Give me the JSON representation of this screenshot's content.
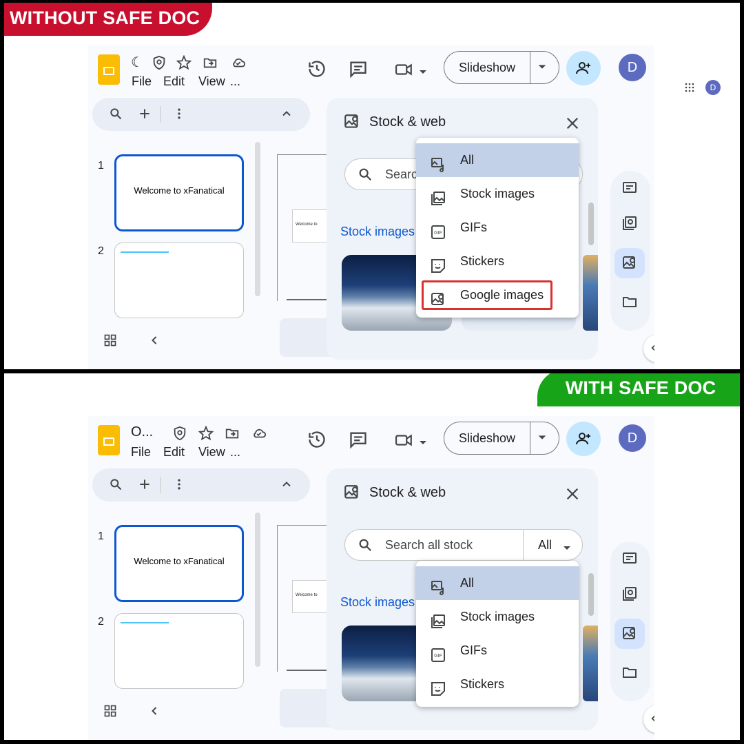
{
  "top_badge": "WITHOUT SAFE DOC",
  "bottom_badge": "WITH SAFE DOC",
  "colors": {
    "badge_red": "#c8102e",
    "badge_green": "#18a418",
    "accent_blue": "#0b57d0",
    "highlight_red": "#d93030"
  },
  "top": {
    "doc_title": "☾",
    "menus": [
      "File",
      "Edit",
      "View",
      "..."
    ],
    "slideshow_label": "Slideshow",
    "avatar_letter": "D",
    "outside_avatar_letter": "D",
    "slides": [
      {
        "number": "1",
        "title": "Welcome to xFanatical"
      },
      {
        "number": "2",
        "title": ""
      }
    ],
    "canvas_text": "Welcome to",
    "panel_title": "Stock & web",
    "search_placeholder": "Search",
    "section_title": "Stock images",
    "dropdown": [
      {
        "label": "All",
        "icon": "all-media-icon",
        "selected": true
      },
      {
        "label": "Stock images",
        "icon": "stock-images-icon"
      },
      {
        "label": "GIFs",
        "icon": "gif-icon"
      },
      {
        "label": "Stickers",
        "icon": "sticker-icon"
      },
      {
        "label": "Google images",
        "icon": "google-images-icon",
        "highlighted": true
      }
    ]
  },
  "bottom": {
    "doc_title": "O...",
    "menus": [
      "File",
      "Edit",
      "View",
      "..."
    ],
    "slideshow_label": "Slideshow",
    "avatar_letter": "D",
    "slides": [
      {
        "number": "1",
        "title": "Welcome to xFanatical"
      },
      {
        "number": "2",
        "title": ""
      }
    ],
    "canvas_text": "Welcome to",
    "panel_title": "Stock & web",
    "search_placeholder": "Search all stock",
    "search_filter": "All",
    "section_title": "Stock images",
    "dropdown": [
      {
        "label": "All",
        "icon": "all-media-icon",
        "selected": true
      },
      {
        "label": "Stock images",
        "icon": "stock-images-icon"
      },
      {
        "label": "GIFs",
        "icon": "gif-icon"
      },
      {
        "label": "Stickers",
        "icon": "sticker-icon"
      }
    ]
  }
}
